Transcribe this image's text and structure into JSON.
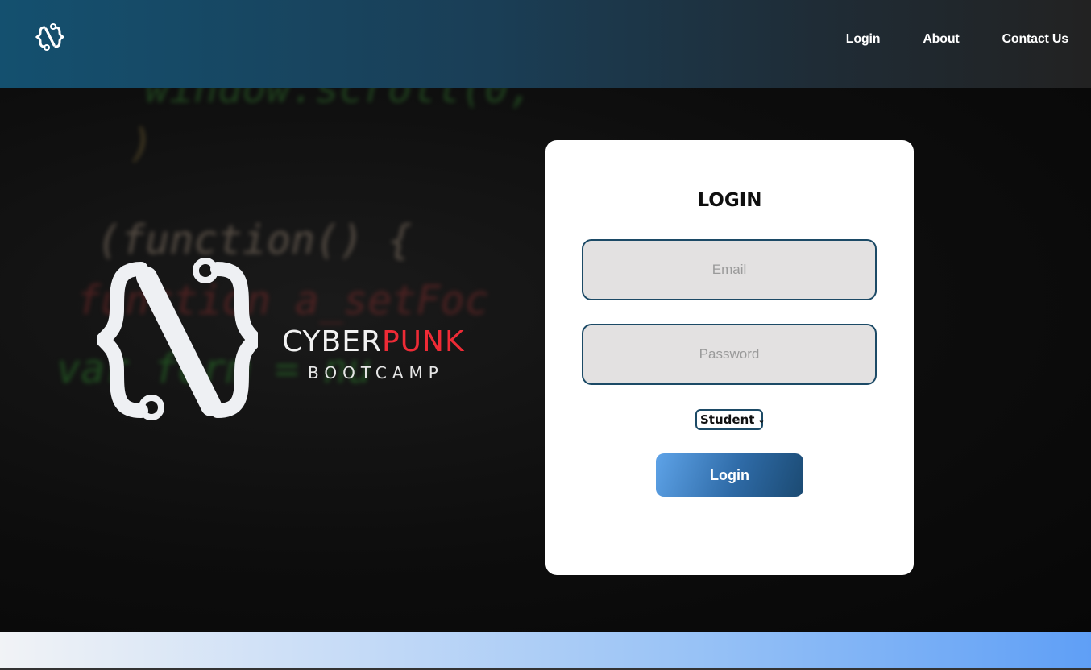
{
  "header": {
    "logo_icon": "curly-brace-n-logo-icon",
    "nav": [
      {
        "label": "Login"
      },
      {
        "label": "About"
      },
      {
        "label": "Contact Us"
      }
    ]
  },
  "hero": {
    "code_lines": [
      "window.scroll(0,",
      ")",
      "(function() {",
      "function a_setFoc",
      "var form = nu"
    ],
    "brand": {
      "word1": "CYBER",
      "word2": "PUNK",
      "tagline": "BOOTCAMP",
      "accent_color": "#ee2b36"
    }
  },
  "login": {
    "title": "LOGIN",
    "email_placeholder": "Email",
    "password_placeholder": "Password",
    "role_selected": "Student",
    "submit_label": "Login"
  }
}
